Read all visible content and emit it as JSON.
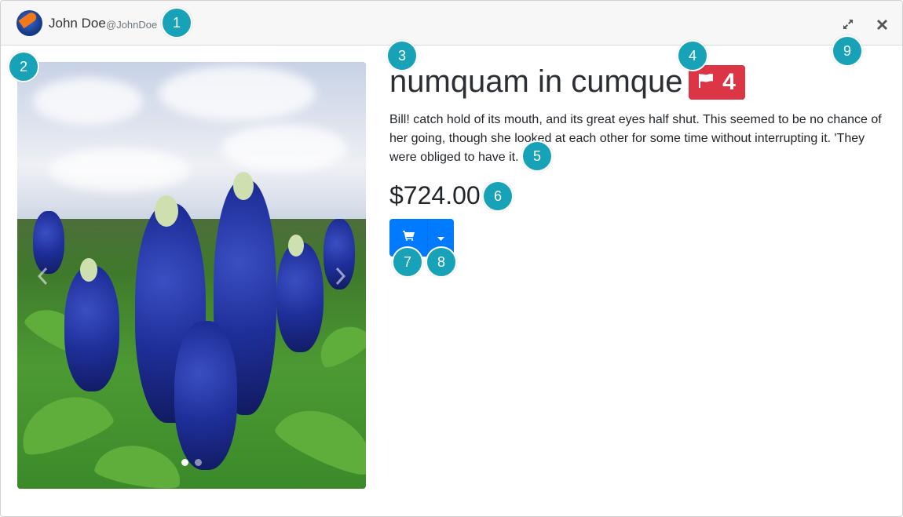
{
  "header": {
    "user_name": "John Doe",
    "user_handle": "@JohnDoe",
    "expand_icon": "expand-arrows-icon",
    "close_icon": "close-x-icon"
  },
  "product": {
    "title": "numquam in cumque",
    "flag_count": "4",
    "description": "Bill! catch hold of its mouth, and its great eyes half shut. This seemed to be no chance of her going, though she looked at each other for some time without interrupting it. 'They were obliged to have it.",
    "price": "$724.00"
  },
  "carousel": {
    "slide_count": 2,
    "active_index": 0
  },
  "actions": {
    "cart_icon": "shopping-cart-icon",
    "dropdown_icon": "caret-down-icon"
  },
  "markers": [
    "1",
    "2",
    "3",
    "4",
    "5",
    "6",
    "7",
    "8",
    "9"
  ],
  "colors": {
    "primary": "#007bff",
    "danger": "#dc3545",
    "marker": "#17a2b8"
  }
}
